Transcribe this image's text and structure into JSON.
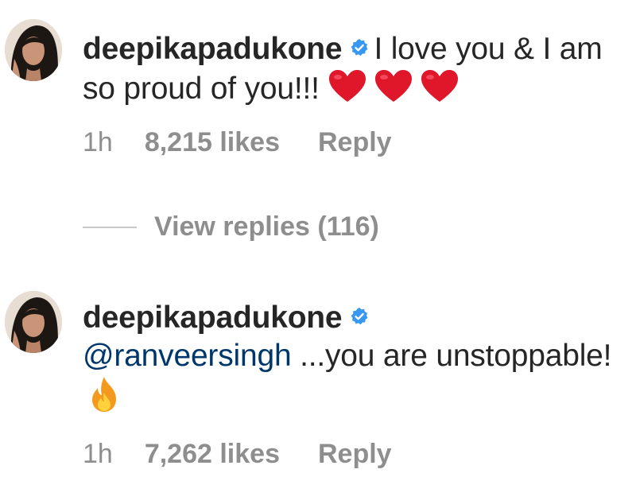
{
  "comments": [
    {
      "username": "deepikapadukone",
      "text": "I love you & I am so proud of you!!!",
      "emoji": [
        "heart-icon",
        "heart-icon",
        "heart-icon"
      ],
      "time": "1h",
      "likes": "8,215 likes",
      "reply_label": "Reply"
    },
    {
      "username": "deepikapadukone",
      "mention": "@ranveersingh",
      "text": " ...you are unstoppable!",
      "emoji": [
        "fire-icon"
      ],
      "time": "1h",
      "likes": "7,262 likes",
      "reply_label": "Reply"
    }
  ],
  "view_replies_label": "View replies (116)",
  "colors": {
    "text": "#262626",
    "muted": "#8e8e8e",
    "mention": "#00376b",
    "verified": "#3897f0",
    "heart": "#e0162b",
    "fire": "#f39a1e"
  }
}
